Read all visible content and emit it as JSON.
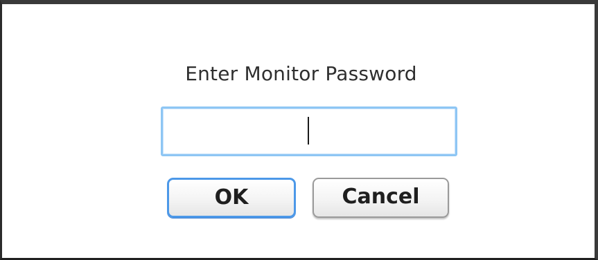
{
  "dialog": {
    "prompt": "Enter Monitor Password",
    "password_value": "",
    "ok_label": "OK",
    "cancel_label": "Cancel",
    "accent_color": "#4c98e8",
    "focus_color": "#8ec6f4"
  }
}
